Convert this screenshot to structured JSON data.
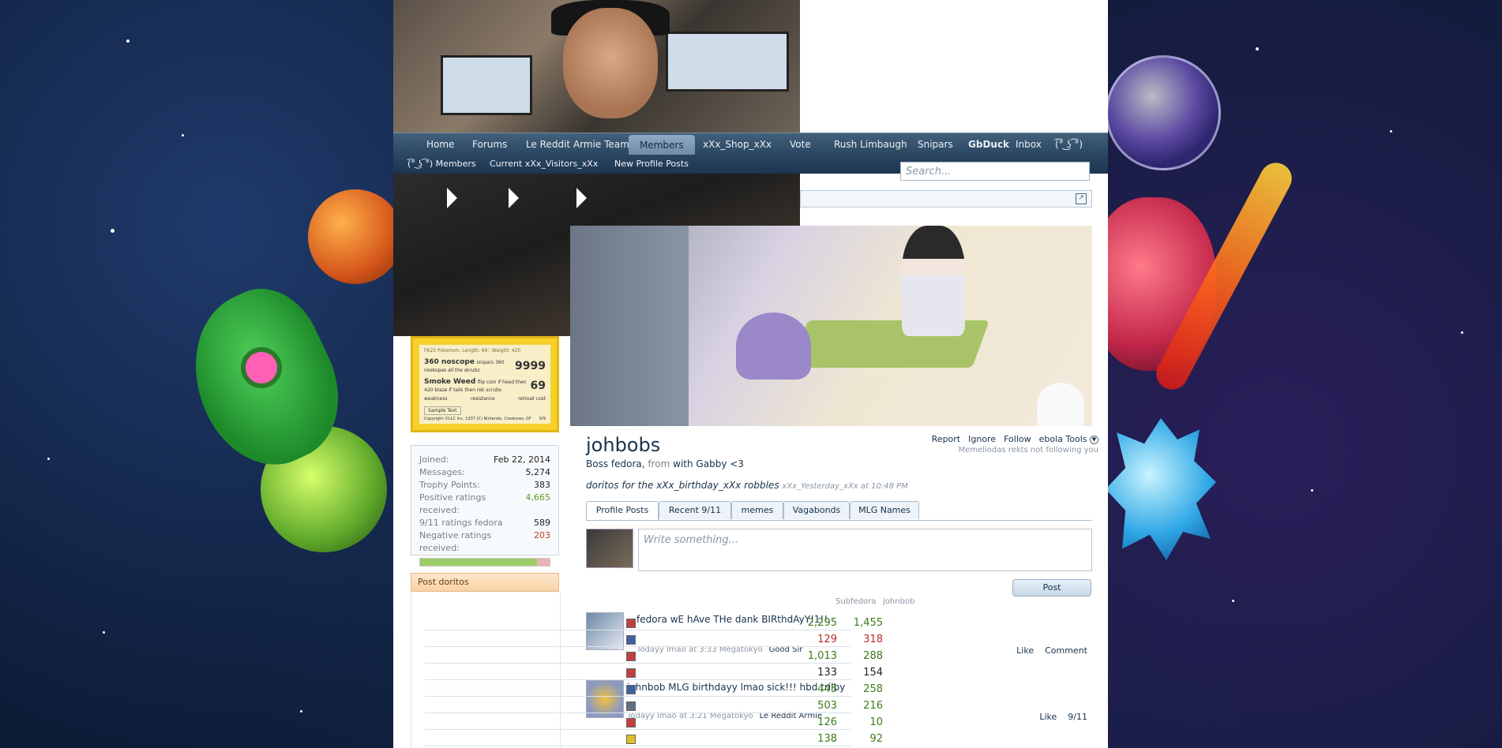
{
  "nav": {
    "items": [
      "Home",
      "Forums",
      "Le Reddit Armie Team",
      "Members",
      "xXx_Shop_xXx",
      "Vote",
      "Rush Limbaugh",
      "Snipars",
      "GbDuck",
      "Inbox",
      "(͡° ͜ʖ ͡°)"
    ],
    "active": "Members"
  },
  "subnav": {
    "items": [
      "(͡° ͜ʖ ͡°) Members",
      "Current xXx_Visitors_xXx",
      "New Profile Posts"
    ]
  },
  "search": {
    "placeholder": "Search..."
  },
  "card": {
    "header": "FK25 Pokemon. Length: 69', Weight: 420",
    "attack1_name": "360 noscope",
    "attack1_desc": "snipars 360 noskopes all the skrubz",
    "attack1_dmg": "9999",
    "attack2_name": "Smoke Weed",
    "attack2_desc": "flip coin if head then 420 blaze if tails then rek scrubs",
    "attack2_dmg": "69",
    "footer_left": "weakness",
    "footer_mid": "resistance",
    "footer_right": "retreat cost",
    "text_label": "Sample Text",
    "copyright": "Copyright ©LLC Inc. 1337 (C) Nintendo, Creatures, GF",
    "code": "6/9"
  },
  "stats": {
    "rows": [
      {
        "label": "Joined:",
        "value": "Feb 22, 2014",
        "tone": ""
      },
      {
        "label": "Messages:",
        "value": "5,274",
        "tone": ""
      },
      {
        "label": "Trophy Points:",
        "value": "383",
        "tone": ""
      },
      {
        "label": "Positive ratings received:",
        "value": "4,665",
        "tone": "green"
      },
      {
        "label": "9/11 ratings fedora",
        "value": "589",
        "tone": ""
      },
      {
        "label": "Negative ratings received:",
        "value": "203",
        "tone": "red"
      }
    ],
    "positive_fraction": 0.9
  },
  "sidebar": {
    "post_heading": "Post doritos"
  },
  "profile": {
    "name": "johbobs",
    "title": "Boss fedora",
    "from_label": "from",
    "location": "with Gabby <3",
    "status_text": "doritos for the xXx_birthday_xXx robbles",
    "status_time": "xXx_Yesterday_xXx at 10:48 PM",
    "actions": [
      "Report",
      "Ignore",
      "Follow",
      "ebola Tools"
    ],
    "follow_note": "Memeliodas rekts not following you"
  },
  "tabs": [
    "Profile Posts",
    "Recent 9/11",
    "memes",
    "Vagabonds",
    "MLG Names"
  ],
  "compose": {
    "placeholder": "Write something...",
    "post_label": "Post"
  },
  "posts": [
    {
      "author": "fedora",
      "text": "wE hAve THe dank BIRthdAyY!1!!",
      "time": "Todayy lmao at 3:33",
      "source": "Megatokyo",
      "category": "Good Sir",
      "actions": [
        "Like",
        "Comment"
      ]
    },
    {
      "author": "johnbob",
      "text": "MLG birthdayy lmao sick!!! hbd trilby",
      "time": "Todayy lmao at 3:21",
      "source": "Megatokyo",
      "category": "Le Reddit Armie",
      "actions": [
        "Like",
        "9/11"
      ]
    }
  ],
  "overlay_table": {
    "head": [
      "Subfedora",
      "johnbob"
    ],
    "rows": [
      {
        "a": "2,295",
        "b": "1,455",
        "color": "#3a7a1a"
      },
      {
        "a": "129",
        "b": "318",
        "color": "#c02a2a"
      },
      {
        "a": "1,013",
        "b": "288",
        "color": "#3a7a1a"
      },
      {
        "a": "133",
        "b": "154",
        "color": "#222222"
      },
      {
        "a": "445",
        "b": "258",
        "color": "#3a7a1a"
      },
      {
        "a": "503",
        "b": "216",
        "color": "#3a7a1a"
      },
      {
        "a": "126",
        "b": "10",
        "color": "#3a7a1a"
      },
      {
        "a": "138",
        "b": "92",
        "color": "#3a7a1a"
      }
    ]
  },
  "colors": {
    "nav_bg": "#2a4660",
    "accent": "#17324c",
    "positive": "#5a9a2a",
    "negative": "#c03a2a"
  }
}
